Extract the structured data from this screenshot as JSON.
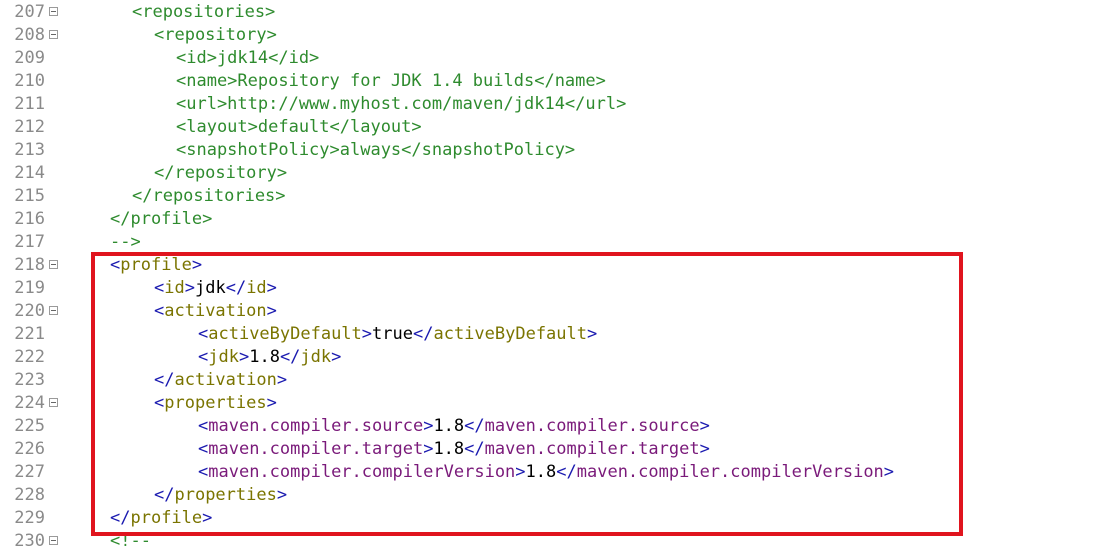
{
  "editor": {
    "highlight_color": "#e0141e",
    "lines": [
      {
        "num": "207",
        "fold": true,
        "tokens": [
          {
            "c": "cm",
            "t": "<repositories>"
          }
        ]
      },
      {
        "num": "208",
        "fold": true,
        "tokens": [
          {
            "c": "cm",
            "t": "<repository>"
          }
        ]
      },
      {
        "num": "209",
        "fold": false,
        "tokens": [
          {
            "c": "cm",
            "t": "<id>jdk14</id>"
          }
        ]
      },
      {
        "num": "210",
        "fold": false,
        "tokens": [
          {
            "c": "cm",
            "t": "<name>Repository for JDK 1.4 builds</name>"
          }
        ]
      },
      {
        "num": "211",
        "fold": false,
        "tokens": [
          {
            "c": "cm",
            "t": "<url>http://www.myhost.com/maven/jdk14</url>"
          }
        ]
      },
      {
        "num": "212",
        "fold": false,
        "tokens": [
          {
            "c": "cm",
            "t": "<layout>default</layout>"
          }
        ]
      },
      {
        "num": "213",
        "fold": false,
        "tokens": [
          {
            "c": "cm",
            "t": "<snapshotPolicy>always</snapshotPolicy>"
          }
        ]
      },
      {
        "num": "214",
        "fold": false,
        "tokens": [
          {
            "c": "cm",
            "t": "</repository>"
          }
        ]
      },
      {
        "num": "215",
        "fold": false,
        "tokens": [
          {
            "c": "cm",
            "t": "</repositories>"
          }
        ]
      },
      {
        "num": "216",
        "fold": false,
        "tokens": [
          {
            "c": "cm",
            "t": "</profile>"
          }
        ]
      },
      {
        "num": "217",
        "fold": false,
        "tokens": [
          {
            "c": "cm",
            "t": "-->"
          }
        ]
      },
      {
        "num": "218",
        "fold": true,
        "tokens": [
          {
            "c": "b",
            "t": "<"
          },
          {
            "c": "tag",
            "t": "profile"
          },
          {
            "c": "b",
            "t": ">"
          }
        ]
      },
      {
        "num": "219",
        "fold": false,
        "tokens": [
          {
            "c": "b",
            "t": "<"
          },
          {
            "c": "tag",
            "t": "id"
          },
          {
            "c": "b",
            "t": ">"
          },
          {
            "c": "txt",
            "t": "jdk"
          },
          {
            "c": "b",
            "t": "</"
          },
          {
            "c": "tag",
            "t": "id"
          },
          {
            "c": "b",
            "t": ">"
          }
        ]
      },
      {
        "num": "220",
        "fold": true,
        "tokens": [
          {
            "c": "b",
            "t": "<"
          },
          {
            "c": "tag",
            "t": "activation"
          },
          {
            "c": "b",
            "t": ">"
          }
        ]
      },
      {
        "num": "221",
        "fold": false,
        "tokens": [
          {
            "c": "b",
            "t": "<"
          },
          {
            "c": "tag",
            "t": "activeByDefault"
          },
          {
            "c": "b",
            "t": ">"
          },
          {
            "c": "txt",
            "t": "true"
          },
          {
            "c": "b",
            "t": "</"
          },
          {
            "c": "tag",
            "t": "activeByDefault"
          },
          {
            "c": "b",
            "t": ">"
          }
        ]
      },
      {
        "num": "222",
        "fold": false,
        "tokens": [
          {
            "c": "b",
            "t": "<"
          },
          {
            "c": "tag",
            "t": "jdk"
          },
          {
            "c": "b",
            "t": ">"
          },
          {
            "c": "txt",
            "t": "1.8"
          },
          {
            "c": "b",
            "t": "</"
          },
          {
            "c": "tag",
            "t": "jdk"
          },
          {
            "c": "b",
            "t": ">"
          }
        ]
      },
      {
        "num": "223",
        "fold": false,
        "tokens": [
          {
            "c": "b",
            "t": "</"
          },
          {
            "c": "tag",
            "t": "activation"
          },
          {
            "c": "b",
            "t": ">"
          }
        ]
      },
      {
        "num": "224",
        "fold": true,
        "tokens": [
          {
            "c": "b",
            "t": "<"
          },
          {
            "c": "tag",
            "t": "properties"
          },
          {
            "c": "b",
            "t": ">"
          }
        ]
      },
      {
        "num": "225",
        "fold": false,
        "tokens": [
          {
            "c": "b",
            "t": "<"
          },
          {
            "c": "ns",
            "t": "maven.compiler.source"
          },
          {
            "c": "b",
            "t": ">"
          },
          {
            "c": "txt",
            "t": "1.8"
          },
          {
            "c": "b",
            "t": "</"
          },
          {
            "c": "ns",
            "t": "maven.compiler.source"
          },
          {
            "c": "b",
            "t": ">"
          }
        ]
      },
      {
        "num": "226",
        "fold": false,
        "tokens": [
          {
            "c": "b",
            "t": "<"
          },
          {
            "c": "ns",
            "t": "maven.compiler.target"
          },
          {
            "c": "b",
            "t": ">"
          },
          {
            "c": "txt",
            "t": "1.8"
          },
          {
            "c": "b",
            "t": "</"
          },
          {
            "c": "ns",
            "t": "maven.compiler.target"
          },
          {
            "c": "b",
            "t": ">"
          }
        ]
      },
      {
        "num": "227",
        "fold": false,
        "tokens": [
          {
            "c": "b",
            "t": "<"
          },
          {
            "c": "ns",
            "t": "maven.compiler.compilerVersion"
          },
          {
            "c": "b",
            "t": ">"
          },
          {
            "c": "txt",
            "t": "1.8"
          },
          {
            "c": "b",
            "t": "</"
          },
          {
            "c": "ns",
            "t": "maven.compiler.compilerVersion"
          },
          {
            "c": "b",
            "t": ">"
          }
        ]
      },
      {
        "num": "228",
        "fold": false,
        "tokens": [
          {
            "c": "b",
            "t": "</"
          },
          {
            "c": "tag",
            "t": "properties"
          },
          {
            "c": "b",
            "t": ">"
          }
        ]
      },
      {
        "num": "229",
        "fold": false,
        "tokens": [
          {
            "c": "b",
            "t": "</"
          },
          {
            "c": "tag",
            "t": "profile"
          },
          {
            "c": "b",
            "t": ">"
          }
        ]
      },
      {
        "num": "230",
        "fold": true,
        "tokens": [
          {
            "c": "cm",
            "t": "<!--"
          }
        ]
      }
    ]
  }
}
